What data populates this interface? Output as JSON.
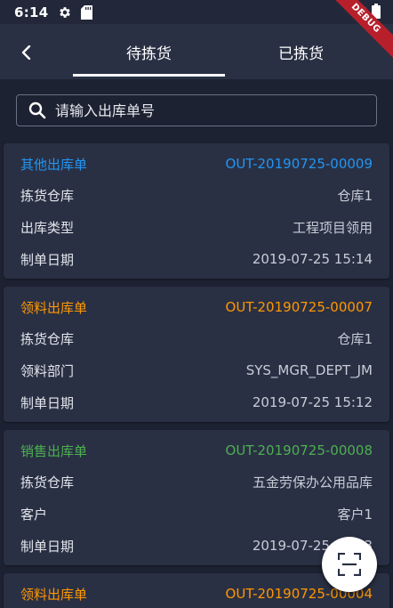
{
  "status_bar": {
    "time": "6:14",
    "debug_label": "DEBUG"
  },
  "tabs": [
    {
      "label": "待拣货",
      "active": true
    },
    {
      "label": "已拣货",
      "active": false
    }
  ],
  "search": {
    "placeholder": "请输入出库单号",
    "value": ""
  },
  "orders": [
    {
      "type": "其他出库单",
      "code": "OUT-20190725-00009",
      "color": "#2196f3",
      "rows": [
        {
          "label": "拣货仓库",
          "value": "仓库1"
        },
        {
          "label": "出库类型",
          "value": "工程项目领用"
        },
        {
          "label": "制单日期",
          "value": "2019-07-25 15:14"
        }
      ]
    },
    {
      "type": "领料出库单",
      "code": "OUT-20190725-00007",
      "color": "#ff9800",
      "rows": [
        {
          "label": "拣货仓库",
          "value": "仓库1"
        },
        {
          "label": "领料部门",
          "value": "SYS_MGR_DEPT_JM"
        },
        {
          "label": "制单日期",
          "value": "2019-07-25 15:12"
        }
      ]
    },
    {
      "type": "销售出库单",
      "code": "OUT-20190725-00008",
      "color": "#4caf50",
      "rows": [
        {
          "label": "拣货仓库",
          "value": "五金劳保办公用品库"
        },
        {
          "label": "客户",
          "value": "客户1"
        },
        {
          "label": "制单日期",
          "value": "2019-07-25 15:13"
        }
      ]
    },
    {
      "type": "领料出库单",
      "code": "OUT-20190725-00004",
      "color": "#ff9800",
      "rows": []
    }
  ],
  "fab": {
    "icon": "scan-icon"
  }
}
